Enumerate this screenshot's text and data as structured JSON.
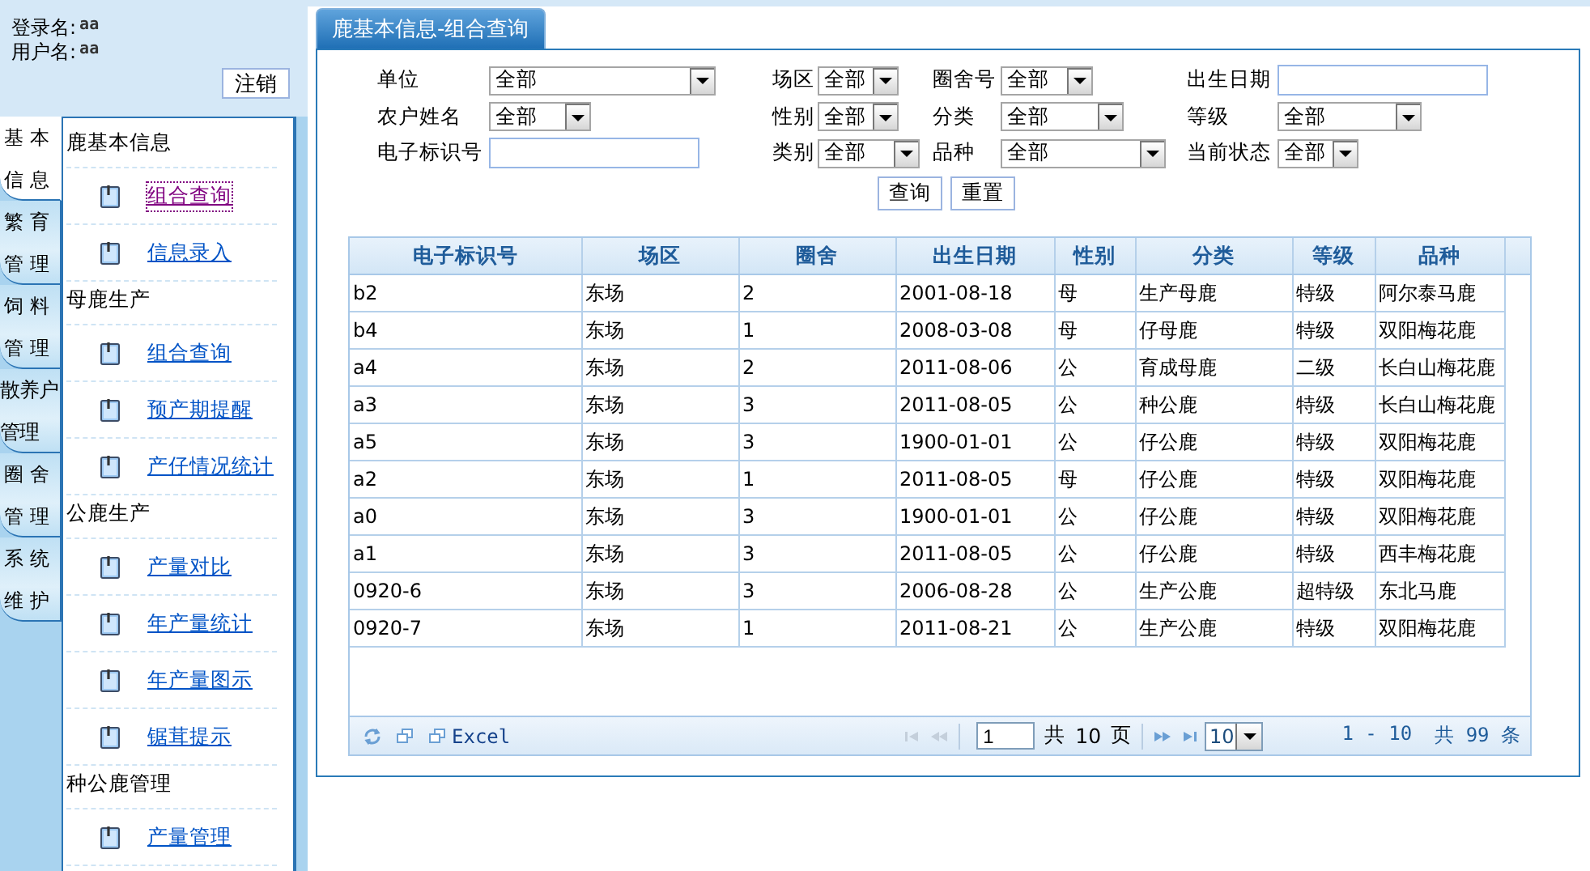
{
  "user": {
    "login_label": "登录名:",
    "login": "aa",
    "user_label": "用户名:",
    "user": "aa",
    "logout": "注销"
  },
  "nav_tabs": [
    {
      "label": "基本信息",
      "selected": true
    },
    {
      "label": "繁育管理",
      "selected": false
    },
    {
      "label": "饲料管理",
      "selected": false
    },
    {
      "label": "散养户管理",
      "selected": false
    },
    {
      "label": "圈舍管理",
      "selected": false
    },
    {
      "label": "系统维护",
      "selected": false
    }
  ],
  "menu": [
    {
      "title": "鹿基本信息",
      "items": [
        {
          "label": "组合查询",
          "selected": true
        },
        {
          "label": "信息录入",
          "selected": false
        }
      ]
    },
    {
      "title": "母鹿生产",
      "items": [
        {
          "label": "组合查询",
          "selected": false
        },
        {
          "label": "预产期提醒",
          "selected": false
        },
        {
          "label": "产仔情况统计",
          "selected": false
        }
      ]
    },
    {
      "title": "公鹿生产",
      "items": [
        {
          "label": "产量对比",
          "selected": false
        },
        {
          "label": "年产量统计",
          "selected": false
        },
        {
          "label": "年产量图示",
          "selected": false
        },
        {
          "label": "锯茸提示",
          "selected": false
        }
      ]
    },
    {
      "title": "种公鹿管理",
      "items": [
        {
          "label": "产量管理",
          "selected": false
        }
      ]
    }
  ],
  "page_tab": {
    "label": "鹿基本信息-组合查询"
  },
  "form": {
    "rows": [
      [
        {
          "label": "单位",
          "kind": "select",
          "value": "全部"
        },
        {
          "label": "场区",
          "kind": "select",
          "value": "全部"
        },
        {
          "label": "圈舍号",
          "kind": "select",
          "value": "全部"
        },
        {
          "label": "出生日期",
          "kind": "input"
        }
      ],
      [
        {
          "label": "农户姓名",
          "kind": "select",
          "value": "全部"
        },
        {
          "label": "性别",
          "kind": "select",
          "value": "全部"
        },
        {
          "label": "分类",
          "kind": "select",
          "value": "全部"
        },
        {
          "label": "等级",
          "kind": "select",
          "value": "全部"
        }
      ],
      [
        {
          "label": "电子标识号",
          "kind": "input"
        },
        {
          "label": "类别",
          "kind": "select",
          "value": "全部"
        },
        {
          "label": "品种",
          "kind": "select",
          "value": "全部"
        },
        {
          "label": "当前状态",
          "kind": "select",
          "value": "全部"
        }
      ]
    ],
    "buttons": [
      "查询",
      "重置"
    ]
  },
  "table": {
    "columns": [
      "电子标识号",
      "场区",
      "圈舍",
      "出生日期",
      "性别",
      "分类",
      "等级",
      "品种"
    ],
    "rows": [
      [
        "b2",
        "东场",
        "2",
        "2001-08-18",
        "母",
        "生产母鹿",
        "特级",
        "阿尔泰马鹿"
      ],
      [
        "b4",
        "东场",
        "1",
        "2008-03-08",
        "母",
        "仔母鹿",
        "特级",
        "双阳梅花鹿"
      ],
      [
        "a4",
        "东场",
        "2",
        "2011-08-06",
        "公",
        "育成母鹿",
        "二级",
        "长白山梅花鹿"
      ],
      [
        "a3",
        "东场",
        "3",
        "2011-08-05",
        "公",
        "种公鹿",
        "特级",
        "长白山梅花鹿"
      ],
      [
        "a5",
        "东场",
        "3",
        "1900-01-01",
        "公",
        "仔公鹿",
        "特级",
        "双阳梅花鹿"
      ],
      [
        "a2",
        "东场",
        "1",
        "2011-08-05",
        "母",
        "仔公鹿",
        "特级",
        "双阳梅花鹿"
      ],
      [
        "a0",
        "东场",
        "3",
        "1900-01-01",
        "公",
        "仔公鹿",
        "特级",
        "双阳梅花鹿"
      ],
      [
        "a1",
        "东场",
        "3",
        "2011-08-05",
        "公",
        "仔公鹿",
        "特级",
        "西丰梅花鹿"
      ],
      [
        "0920-6",
        "东场",
        "3",
        "2006-08-28",
        "公",
        "生产公鹿",
        "超特级",
        "东北马鹿"
      ],
      [
        "0920-7",
        "东场",
        "1",
        "2011-08-21",
        "公",
        "生产公鹿",
        "特级",
        "双阳梅花鹿"
      ]
    ]
  },
  "pager": {
    "export": "Excel",
    "page": "1",
    "of": "共",
    "pages": "10",
    "unit": "页",
    "page_size": "10",
    "range": "1 - 10",
    "total": "共 99 条"
  }
}
